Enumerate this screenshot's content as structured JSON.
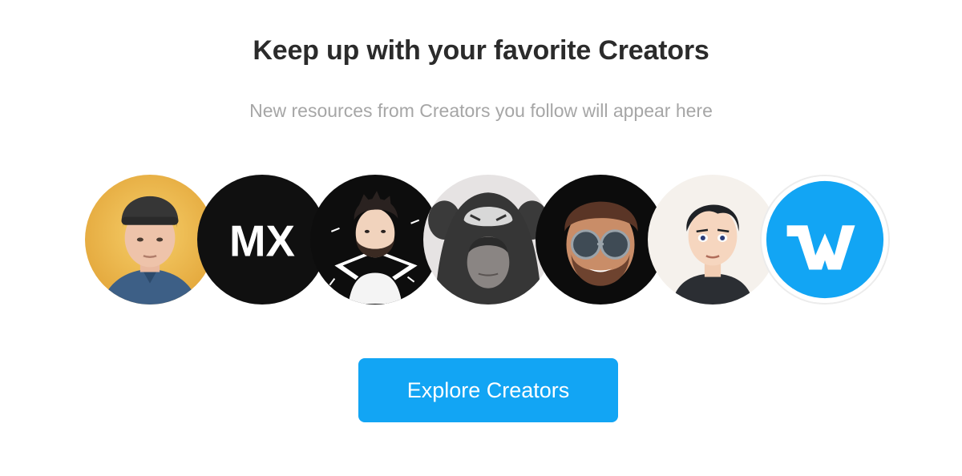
{
  "header": {
    "title": "Keep up with your favorite Creators",
    "subtitle": "New resources from Creators you follow will appear here"
  },
  "creators": [
    {
      "avatar": "photo-man-beanie"
    },
    {
      "avatar": "mx-logo",
      "logo_text": "MX"
    },
    {
      "avatar": "illustrated-bearded-man"
    },
    {
      "avatar": "photo-hooded-gorilla"
    },
    {
      "avatar": "memoji-sunglasses"
    },
    {
      "avatar": "cartoon-man"
    },
    {
      "avatar": "w-logo",
      "brand_color": "#12a5f4"
    }
  ],
  "cta": {
    "label": "Explore Creators",
    "color": "#12a5f4"
  }
}
